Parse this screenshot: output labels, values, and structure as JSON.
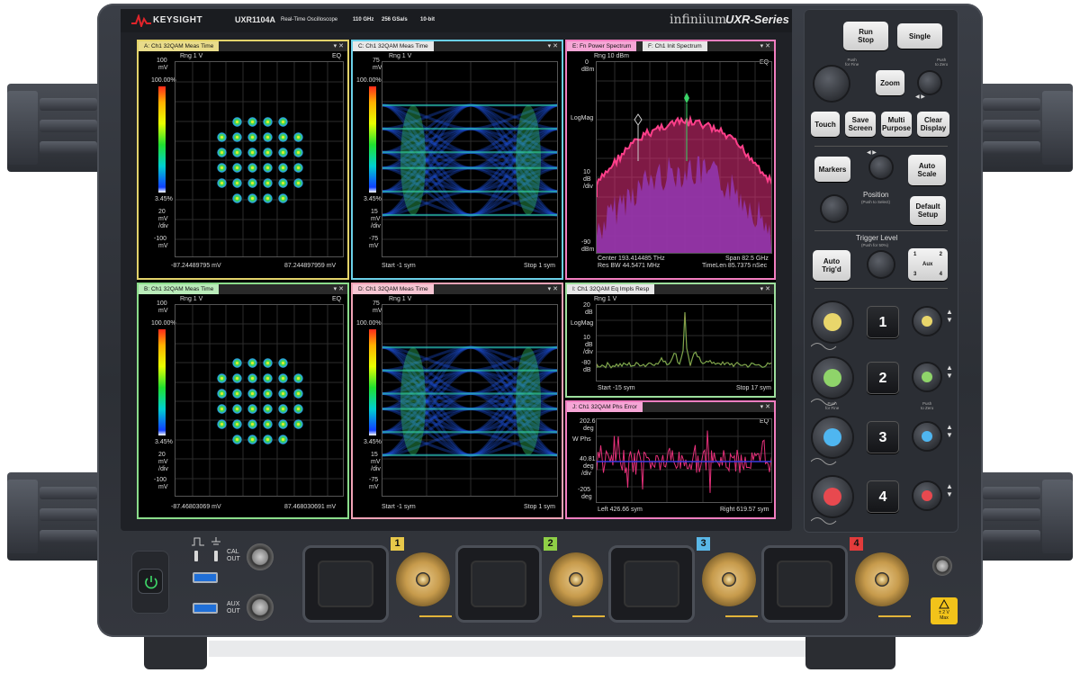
{
  "header": {
    "brand": "KEYSIGHT",
    "model": "UXR1104A",
    "description": "Real-Time Oscilloscope",
    "bandwidth": "110 GHz",
    "sample_rate": "256 GSa/s",
    "bits": "10-bit",
    "software": "infiniium",
    "series": "UXR-Series"
  },
  "panels": {
    "a": {
      "tab": "A: Ch1 32QAM Meas Time",
      "ring": "Rng 1 V",
      "eq": "EQ",
      "ytop": "100",
      "yunit": "mV",
      "pct_top": "100.00%",
      "pct_bot": "3.45%",
      "scale_val": "20",
      "scale_unit": "mV",
      "scale_div": "/div",
      "ybot": "-100",
      "ybot_unit": "mV",
      "xleft": "-87.24489795 mV",
      "xright": "87.244897959 mV"
    },
    "b": {
      "tab": "B: Ch1 32QAM Meas Time",
      "ring": "Rng 1 V",
      "eq": "EQ",
      "ytop": "100",
      "yunit": "mV",
      "pct_top": "100.00%",
      "pct_bot": "3.45%",
      "scale_val": "20",
      "scale_unit": "mV",
      "scale_div": "/div",
      "ybot": "-100",
      "ybot_unit": "mV",
      "xleft": "-87.46803069 mV",
      "xright": "87.468030691 mV"
    },
    "c": {
      "tab": "C: Ch1 32QAM Meas Time",
      "ring": "Rng 1 V",
      "ytop": "75",
      "yunit": "mV",
      "pct_top": "100.00%",
      "pct_bot": "3.45%",
      "scale_val": "15",
      "scale_unit": "mV",
      "scale_div": "/div",
      "ybot": "-75",
      "ybot_unit": "mV",
      "xleft": "Start -1 sym",
      "xright": "Stop 1 sym"
    },
    "d": {
      "tab": "D: Ch1 32QAM Meas Time",
      "ring": "Rng 1 V",
      "ytop": "75",
      "yunit": "mV",
      "pct_top": "100.00%",
      "pct_bot": "3.45%",
      "scale_val": "15",
      "scale_unit": "mV",
      "scale_div": "/div",
      "ybot": "-75",
      "ybot_unit": "mV",
      "xleft": "Start -1 sym",
      "xright": "Stop 1 sym"
    },
    "e": {
      "tab1": "E: Fn Power Spectrum",
      "tab2": "F: Ch1 Init Spectrum",
      "ring": "Rng 10 dBm",
      "eq": "EQ",
      "ytop": "0",
      "yunit": "dBm",
      "ylabel": "LogMag",
      "scale_val": "10",
      "scale_unit": "dB",
      "scale_div": "/div",
      "ybot": "-90",
      "ybot_unit": "dBm",
      "center": "Center 193.414485 THz",
      "span": "Span 82.5 GHz",
      "rbw": "Res BW 44.5471 MHz",
      "timelen": "TimeLen 85.7375 nSec"
    },
    "i": {
      "tab": "I: Ch1 32QAM Eq Impls Resp",
      "ring": "Rng 1 V",
      "ytop": "20",
      "yunit": "dB",
      "ylabel": "LogMag",
      "scale_val": "10",
      "scale_unit": "dB",
      "scale_div": "/div",
      "ybot": "-80",
      "ybot_unit": "dB",
      "xleft": "Start -15 sym",
      "xright": "Stop 17 sym"
    },
    "j": {
      "tab": "J: Ch1 32QAM Phs Error",
      "eq": "EQ",
      "ytop": "202.6",
      "yunit": "deg",
      "ylabel": "W Phs",
      "scale_val": "40.81",
      "scale_unit": "deg",
      "scale_div": "/div",
      "ybot": "-205",
      "ybot_unit": "deg",
      "xleft": "Left 426.66 sym",
      "xright": "Right 619.57 sym"
    }
  },
  "controls": {
    "run_stop": [
      "Run",
      "Stop"
    ],
    "single": "Single",
    "push_fine": [
      "Push",
      "for Fine"
    ],
    "push_zero": [
      "Push",
      "to Zero"
    ],
    "zoom": "Zoom",
    "touch": "Touch",
    "save_screen": [
      "Save",
      "Screen"
    ],
    "multi_purpose": [
      "Multi",
      "Purpose"
    ],
    "clear_display": [
      "Clear",
      "Display"
    ],
    "markers": "Markers",
    "auto_scale": [
      "Auto",
      "Scale"
    ],
    "position": "Position",
    "position_hint": "(Push to Select)",
    "default_setup": [
      "Default",
      "Setup"
    ],
    "trigger_level": "Trigger Level",
    "trigger_hint": "(Push for 50%)",
    "auto_trigd": [
      "Auto",
      "Trig'd"
    ],
    "aux": "Aux",
    "channels": [
      "1",
      "2",
      "3",
      "4"
    ],
    "channel_colors": [
      "#e9d66b",
      "#8fd46a",
      "#4fb6f0",
      "#e8494f"
    ]
  },
  "front": {
    "cal_out": [
      "CAL",
      "OUT"
    ],
    "aux_out": [
      "AUX",
      "OUT"
    ],
    "ch_badges": [
      "1",
      "2",
      "3",
      "4"
    ],
    "badge_colors": [
      "#e8c84a",
      "#8fd046",
      "#5ab8e8",
      "#e23b3b"
    ],
    "warning": [
      "± 2 V",
      "Max"
    ]
  }
}
